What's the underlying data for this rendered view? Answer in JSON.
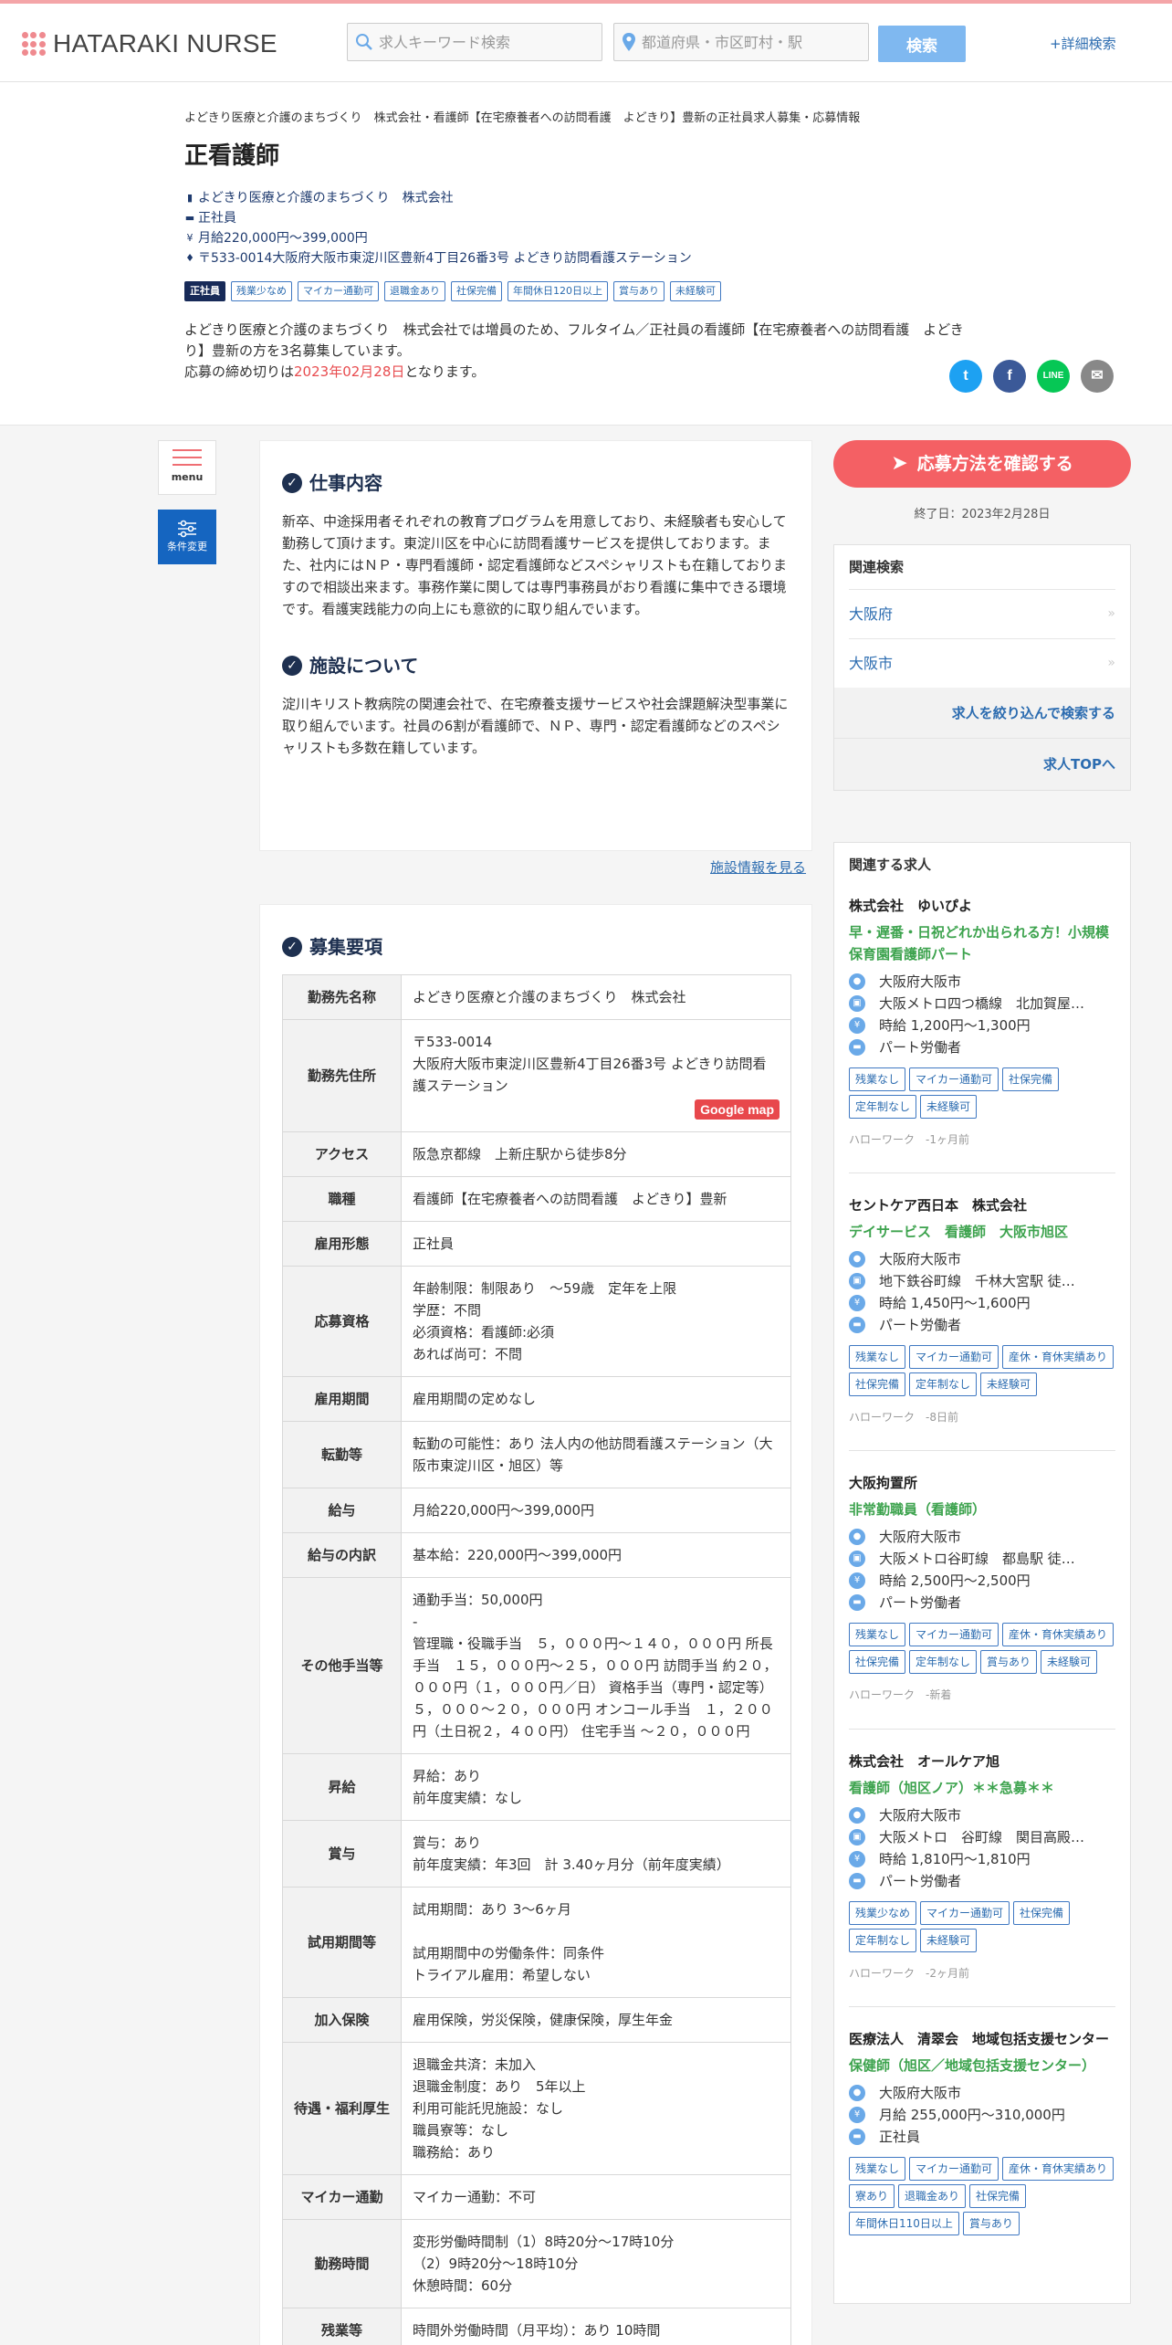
{
  "header": {
    "logo_text": "HATARAKI NURSE",
    "keyword_placeholder": "求人キーワード検索",
    "location_placeholder": "都道府県・市区町村・駅",
    "search_label": "検索",
    "detail_search": "+詳細検索"
  },
  "job": {
    "breadcrumb": "よどきり医療と介護のまちづくり　株式会社・看護師【在宅療養者への訪問看護　よどきり】豊新の正社員求人募集・応募情報",
    "title": "正看護師",
    "company": "よどきり医療と介護のまちづくり　株式会社",
    "employment": "正社員",
    "salary": "月給220,000円〜399,000円",
    "address": "〒533-0014大阪府大阪市東淀川区豊新4丁目26番3号 よどきり訪問看護ステーション",
    "tags": [
      "正社員",
      "残業少なめ",
      "マイカー通勤可",
      "退職金あり",
      "社保完備",
      "年間休日120日以上",
      "賞与あり",
      "未経験可"
    ],
    "intro_1": "よどきり医療と介護のまちづくり　株式会社では増員のため、フルタイム／正社員の看護師【在宅療養者への訪問看護　よどきり】豊新の方を3名募集しています。",
    "intro_2_prefix": "応募の締め切りは",
    "intro_2_date": "2023年02月28日",
    "intro_2_suffix": "となります。"
  },
  "share": {
    "twitter": "t",
    "facebook": "f",
    "line": "LINE",
    "mail": "✉"
  },
  "side_nav": {
    "menu_label": "menu",
    "filter_label": "条件変更"
  },
  "work": {
    "title": "仕事内容",
    "text": "新卒、中途採用者それぞれの教育プログラムを用意しており、未経験者も安心して勤務して頂けます。東淀川区を中心に訪問看護サービスを提供しております。また、社内にはＮＰ・専門看護師・認定看護師などスペシャリストも在籍しておりますので相談出来ます。事務作業に関しては専門事務員がおり看護に集中できる環境です。看護実践能力の向上にも意欲的に取り組んでいます。"
  },
  "facility": {
    "title": "施設について",
    "text": "淀川キリスト教病院の関連会社で、在宅療養支援サービスや社会課題解決型事業に取り組んでいます。社員の6割が看護師で、ＮＰ、専門・認定看護師などのスペシャリストも多数在籍しています。",
    "link": "施設情報を見る"
  },
  "requirements": {
    "title": "募集要項",
    "map_label": "Google map",
    "rows": [
      {
        "label": "勤務先名称",
        "value": "よどきり医療と介護のまちづくり　株式会社"
      },
      {
        "label": "勤務先住所",
        "value": "〒533-0014\n大阪府大阪市東淀川区豊新4丁目26番3号 よどきり訪問看護ステーション"
      },
      {
        "label": "アクセス",
        "value": "阪急京都線　上新庄駅から徒歩8分"
      },
      {
        "label": "職種",
        "value": "看護師【在宅療養者への訪問看護　よどきり】豊新"
      },
      {
        "label": "雇用形態",
        "value": "正社員"
      },
      {
        "label": "応募資格",
        "value": "年齢制限：制限あり　〜59歳　定年を上限\n学歴：不問\n必須資格：看護師:必須\nあれば尚可：不問"
      },
      {
        "label": "雇用期間",
        "value": "雇用期間の定めなし"
      },
      {
        "label": "転勤等",
        "value": "転勤の可能性：あり 法人内の他訪問看護ステーション（大阪市東淀川区・旭区）等"
      },
      {
        "label": "給与",
        "value": "月給220,000円〜399,000円"
      },
      {
        "label": "給与の内訳",
        "value": "基本給：220,000円〜399,000円"
      },
      {
        "label": "その他手当等",
        "value": "通勤手当：50,000円\n-\n管理職・役職手当　５，０００円〜１４０，０００円 所長手当　１５，０００円〜２５，０００円 訪問手当 約２０，０００円（１，０００円／日） 資格手当（専門・認定等）５，０００〜２０，０００円 オンコール手当　１，２００円（土日祝２，４００円） 住宅手当 〜２０，０００円"
      },
      {
        "label": "昇給",
        "value": "昇給：あり\n前年度実績：なし"
      },
      {
        "label": "賞与",
        "value": "賞与：あり\n前年度実績：年3回　計 3.40ヶ月分（前年度実績）"
      },
      {
        "label": "試用期間等",
        "value": "試用期間：あり 3〜6ヶ月\n\n試用期間中の労働条件：同条件\nトライアル雇用：希望しない"
      },
      {
        "label": "加入保険",
        "value": "雇用保険，労災保険，健康保険，厚生年金"
      },
      {
        "label": "待遇・福利厚生",
        "value": "退職金共済：未加入\n退職金制度：あり　5年以上\n利用可能託児施設：なし\n職員寮等：なし\n職務給：あり"
      },
      {
        "label": "マイカー通勤",
        "value": "マイカー通勤：不可"
      },
      {
        "label": "勤務時間",
        "value": "変形労働時間制（1）8時20分〜17時10分\n（2）9時20分〜18時10分\n休憩時間：60分"
      },
      {
        "label": "残業等",
        "value": "時間外労働時間（月平均）：あり 10時間"
      }
    ]
  },
  "sidebar": {
    "apply_label": "応募方法を確認する",
    "end_date": "終了日：2023年2月28日",
    "related_title": "関連検索",
    "related_links": [
      "大阪府",
      "大阪市"
    ],
    "refine_link": "求人を絞り込んで検索する",
    "top_link": "求人TOPへ",
    "jobs_title": "関連する求人",
    "jobs": [
      {
        "company": "株式会社　ゆいぴよ",
        "title": "早・遅番・日祝どれか出られる方！小規模保育園看護師パート",
        "location": "大阪府大阪市",
        "station": "大阪メトロ四つ橋線　北加賀屋…",
        "salary": "時給 1,200円〜1,300円",
        "type": "パート労働者",
        "tags": [
          "残業なし",
          "マイカー通勤可",
          "社保完備",
          "定年制なし",
          "未経験可"
        ],
        "source": "ハローワーク　-1ヶ月前"
      },
      {
        "company": "セントケア西日本　株式会社",
        "title": "デイサービス　看護師　大阪市旭区",
        "location": "大阪府大阪市",
        "station": "地下鉄谷町線　千林大宮駅 徒…",
        "salary": "時給 1,450円〜1,600円",
        "type": "パート労働者",
        "tags": [
          "残業なし",
          "マイカー通勤可",
          "産休・育休実績あり",
          "社保完備",
          "定年制なし",
          "未経験可"
        ],
        "source": "ハローワーク　-8日前"
      },
      {
        "company": "大阪拘置所",
        "title": "非常勤職員（看護師）",
        "location": "大阪府大阪市",
        "station": "大阪メトロ谷町線　都島駅 徒…",
        "salary": "時給 2,500円〜2,500円",
        "type": "パート労働者",
        "tags": [
          "残業なし",
          "マイカー通勤可",
          "産休・育休実績あり",
          "社保完備",
          "定年制なし",
          "賞与あり",
          "未経験可"
        ],
        "source": "ハローワーク　-新着"
      },
      {
        "company": "株式会社　オールケア旭",
        "title": "看護師（旭区ノア）＊＊急募＊＊",
        "location": "大阪府大阪市",
        "station": "大阪メトロ　谷町線　関目高殿…",
        "salary": "時給 1,810円〜1,810円",
        "type": "パート労働者",
        "tags": [
          "残業少なめ",
          "マイカー通勤可",
          "社保完備",
          "定年制なし",
          "未経験可"
        ],
        "source": "ハローワーク　-2ヶ月前"
      },
      {
        "company": "医療法人　清翠会　地域包括支援センター",
        "title": "保健師（旭区／地域包括支援センター）",
        "location": "大阪府大阪市",
        "station": "",
        "salary": "月給 255,000円〜310,000円",
        "type": "正社員",
        "tags": [
          "残業なし",
          "マイカー通勤可",
          "産休・育休実績あり",
          "寮あり",
          "退職金あり",
          "社保完備",
          "年間休日110日以上",
          "賞与あり"
        ],
        "source": ""
      }
    ]
  },
  "colors": {
    "accent": "#f46064",
    "link": "#2c6cb0",
    "navy": "#1e3050",
    "green": "#3da34e",
    "search_btn": "#7fb8f0"
  }
}
